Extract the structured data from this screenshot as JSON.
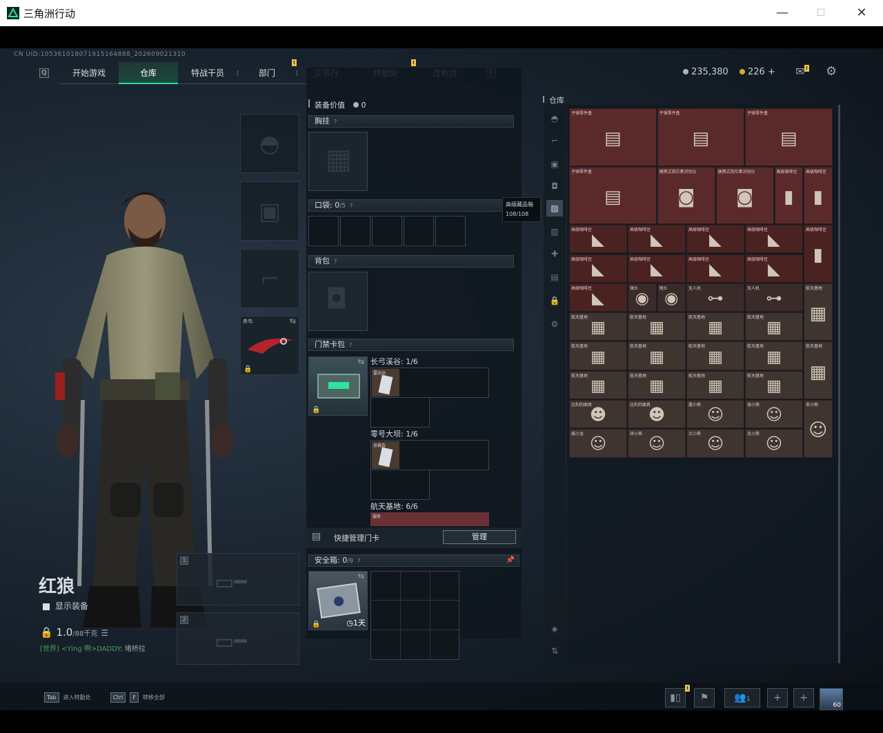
{
  "window": {
    "title": "三角洲行动",
    "minimize": "—",
    "maximize": "☐",
    "close": "✕"
  },
  "uid": "CN UID:105361018071915164888_202609021310",
  "nav": {
    "left_key": "Q",
    "right_key": "E",
    "tabs": [
      {
        "label": "开始游戏"
      },
      {
        "label": "仓库",
        "active": true
      },
      {
        "label": "特战干员"
      },
      {
        "label": "部门"
      },
      {
        "label": "交易行"
      },
      {
        "label": "特勤处"
      },
      {
        "label": "改枪台"
      }
    ],
    "badge": "!"
  },
  "currency": {
    "silver": "235,380",
    "gold": "226",
    "plus": "+"
  },
  "operator": {
    "name": "红狼",
    "show_equipment": "显示装备",
    "weight": "1.0",
    "weight_max": "/88千克",
    "status_green": "[世界] <Ying 啊>DADDY",
    "status_grey": ": 堵桥拉"
  },
  "hints": {
    "tab_key": "Tab",
    "tab_label": "进入特勤处",
    "ctrl_key": "Ctrl",
    "f_key": "F",
    "ctrl_label": "转移全部"
  },
  "melee": {
    "label": "赤鸟"
  },
  "slots": {
    "weapon1": "1",
    "weapon2": "2"
  },
  "equipment": {
    "value_label": "装备价值",
    "value": "0",
    "chest_rig": "胸挂",
    "pocket": "口袋:",
    "pocket_count": "0",
    "pocket_max": "/5",
    "backpack": "背包",
    "keycard": "门禁卡包",
    "maps": [
      {
        "name": "长弓溪谷: 1/6",
        "card": "雷达站"
      },
      {
        "name": "零号大坝: 1/6",
        "card": "总裁会"
      },
      {
        "name": "航天基地: 6/6",
        "card": "服务"
      }
    ],
    "quick_manage": "快捷管理门卡",
    "manage_btn": "管理",
    "safebox": "安全箱:",
    "safebox_count": "0",
    "safebox_max": "/9",
    "safebox_time": "1天",
    "help": "?"
  },
  "tooltip": {
    "line1": "高级藏品箱",
    "line2": "108/108"
  },
  "storage": {
    "label": "仓库",
    "items": {
      "bullet_parts": "子弹零件盒",
      "id_scanner": "便携式岗位素识别仪",
      "coffee": "高级咖啡豆",
      "detector": "镜头",
      "drone": "无人机",
      "map": "航天基地",
      "doll": "比利的面具",
      "lucky": "露小熊",
      "luck2": "洛小熊",
      "hat": "赤小熊",
      "dragon": "威小龙",
      "wing": "祥小熊",
      "ship": "兰小熊",
      "cat": "克小熊"
    }
  },
  "bottom": {
    "team_count": "1",
    "level": "60"
  }
}
